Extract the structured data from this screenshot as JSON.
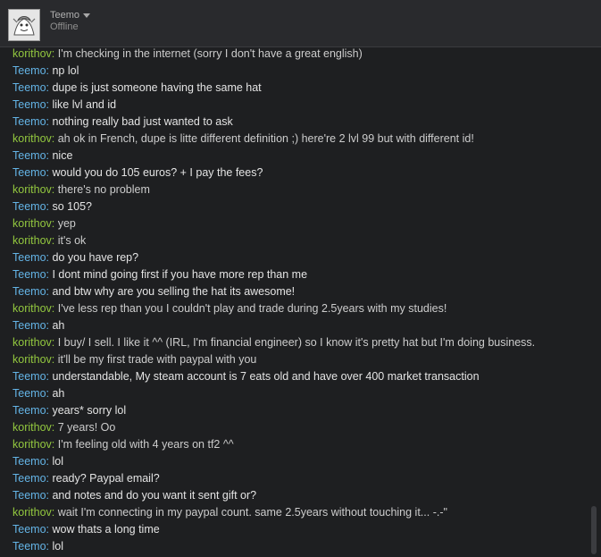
{
  "header": {
    "username": "Teemo",
    "status": "Offline"
  },
  "messages": [
    {
      "speaker": "korithov",
      "text": "I'm checking in the internet (sorry I don't have a great english)"
    },
    {
      "speaker": "Teemo",
      "text": "np lol"
    },
    {
      "speaker": "Teemo",
      "text": "dupe is just someone having the same hat"
    },
    {
      "speaker": "Teemo",
      "text": "like lvl and id"
    },
    {
      "speaker": "Teemo",
      "text": "nothing really bad just wanted to ask"
    },
    {
      "speaker": "korithov",
      "text": "ah ok in French, dupe is litte different definition ;) here're 2 lvl 99 but with different id!"
    },
    {
      "speaker": "Teemo",
      "text": "nice"
    },
    {
      "speaker": "Teemo",
      "text": "would you do 105 euros? + I pay the fees?"
    },
    {
      "speaker": "korithov",
      "text": "there's no problem"
    },
    {
      "speaker": "Teemo",
      "text": "so 105?"
    },
    {
      "speaker": "korithov",
      "text": "yep"
    },
    {
      "speaker": "korithov",
      "text": "it's ok"
    },
    {
      "speaker": "Teemo",
      "text": "do you have rep?"
    },
    {
      "speaker": "Teemo",
      "text": "I dont mind going first if you have more rep than me"
    },
    {
      "speaker": "Teemo",
      "text": "and btw why are you selling the hat its awesome!"
    },
    {
      "speaker": "korithov",
      "text": "I've less rep than you I couldn't play and trade during 2.5years with my studies!"
    },
    {
      "speaker": "Teemo",
      "text": "ah"
    },
    {
      "speaker": "korithov",
      "text": "I buy/ I sell. I like it ^^ (IRL, I'm financial engineer) so I know it's pretty hat but I'm doing business."
    },
    {
      "speaker": "korithov",
      "text": "it'll be my first trade with paypal with you"
    },
    {
      "speaker": "Teemo",
      "text": "understandable, My steam account is 7 eats old and have over 400 market transaction"
    },
    {
      "speaker": "Teemo",
      "text": "ah"
    },
    {
      "speaker": "Teemo",
      "text": "years* sorry lol"
    },
    {
      "speaker": "korithov",
      "text": "7 years! Oo"
    },
    {
      "speaker": "korithov",
      "text": "I'm feeling old with 4 years on tf2 ^^"
    },
    {
      "speaker": "Teemo",
      "text": "lol"
    },
    {
      "speaker": "Teemo",
      "text": "ready? Paypal email?"
    },
    {
      "speaker": "Teemo",
      "text": "and notes and do you want it sent gift or?"
    },
    {
      "speaker": "korithov",
      "text": "wait I'm connecting in my paypal count. same 2.5years without touching it... -.-\""
    },
    {
      "speaker": "Teemo",
      "text": "wow thats a long time"
    },
    {
      "speaker": "Teemo",
      "text": "lol"
    }
  ]
}
